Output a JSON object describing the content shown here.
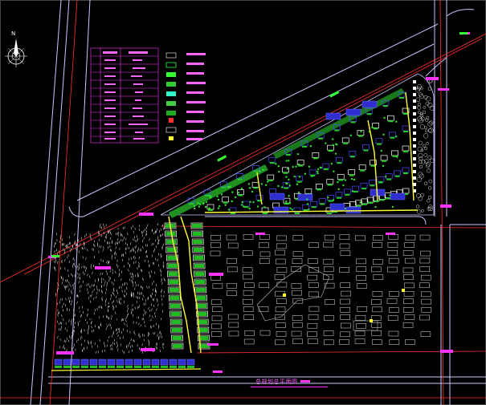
{
  "drawing": {
    "title": "总规划总平面图",
    "north_label": "N"
  },
  "colors": {
    "background": "#000000",
    "road_line": "#c0c0ff",
    "red_line": "#ff3030",
    "building_fill": "#3a3aff",
    "green_fill": "#22cc22",
    "yellow_line": "#ffff33",
    "label_magenta": "#ff33ff",
    "tree_white": "#ffffff"
  },
  "icons": [
    "compass-rose-icon"
  ]
}
